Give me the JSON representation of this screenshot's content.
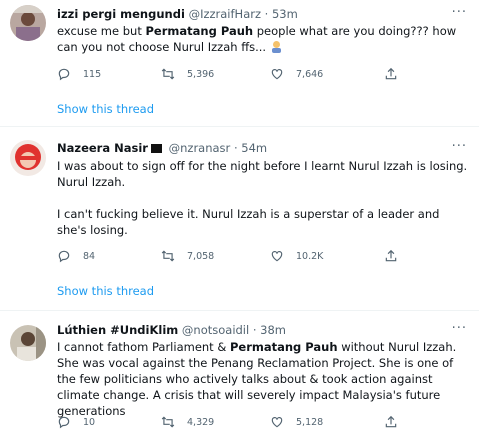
{
  "tweets": [
    {
      "name": "izzi pergi mengundi",
      "handle": "@IzzraifHarz",
      "dot": "·",
      "time": "53m",
      "more": "···",
      "body_pre": "excuse me but ",
      "body_bold": "Permatang Pauh",
      "body_post": " people what are you doing??? how can you not choose Nurul Izzah ffs... ",
      "stats": {
        "replies": "115",
        "retweets": "5,396",
        "likes": "7,646"
      },
      "show_thread": "Show this thread"
    },
    {
      "name": "Nazeera Nasir",
      "handle": "@nzranasr",
      "dot": "·",
      "time": "54m",
      "more": "···",
      "body_pre": "I was about to sign off for the night before I learnt Nurul Izzah is losing. Nurul Izzah.\n\nI can't fucking believe it. Nurul Izzah is a superstar of a leader and she's losing.",
      "stats": {
        "replies": "84",
        "retweets": "7,058",
        "likes": "10.2K"
      },
      "show_thread": "Show this thread"
    },
    {
      "name": "Lúthien #UndiKlim",
      "handle": "@notsoaidil",
      "dot": "·",
      "time": "38m",
      "more": "···",
      "body_pre": "I cannot fathom Parliament & ",
      "body_bold": "Permatang Pauh",
      "body_post": " without Nurul Izzah. She was vocal against the Penang Reclamation Project. She is one of the few politicians who actively talks about & took action against climate change. A crisis that will severely impact Malaysia's future generations",
      "stats": {
        "replies": "10",
        "retweets": "4,329",
        "likes": "5,128"
      }
    }
  ],
  "colors": {
    "accent": "#1d9bf0",
    "muted": "#536471"
  },
  "icons": [
    "reply-icon",
    "retweet-icon",
    "like-icon",
    "share-icon",
    "more-icon"
  ]
}
